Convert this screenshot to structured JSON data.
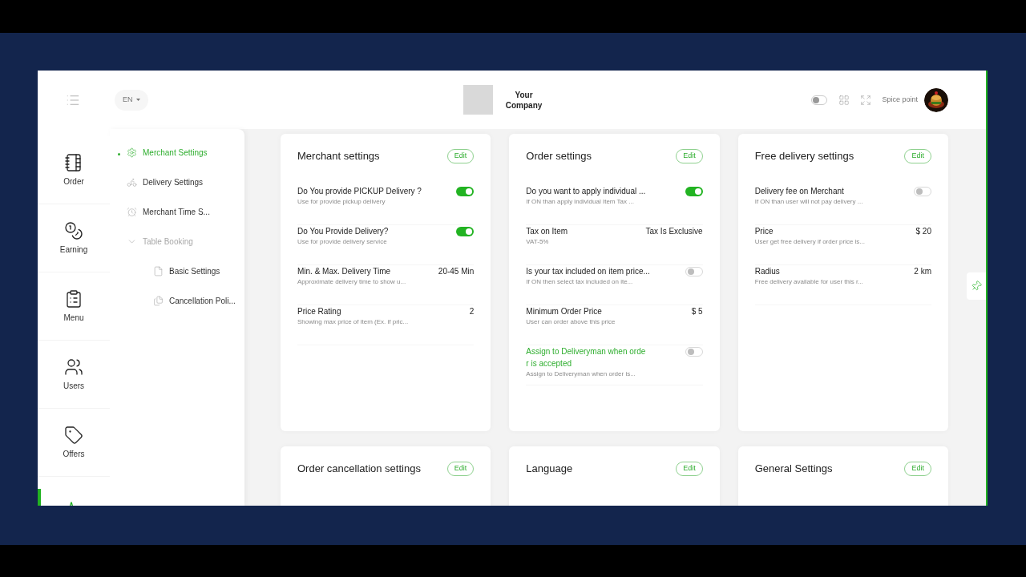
{
  "header": {
    "language": "EN",
    "company": "Your Company",
    "theme_toggle": {
      "on": false
    },
    "user_name": "Spice point"
  },
  "rail": [
    {
      "label": "Order",
      "selected": false
    },
    {
      "label": "Earning",
      "selected": false
    },
    {
      "label": "Menu",
      "selected": false
    },
    {
      "label": "Users",
      "selected": false
    },
    {
      "label": "Offers",
      "selected": false
    },
    {
      "selected": true
    }
  ],
  "submenu": [
    {
      "label": "Merchant Settings",
      "selected": true
    },
    {
      "label": "Delivery Settings",
      "selected": false
    },
    {
      "label": "Merchant Time S...",
      "selected": false
    },
    {
      "label": "Table Booking",
      "selected": false,
      "expanded": true,
      "children": [
        {
          "label": "Basic Settings",
          "selected": false
        },
        {
          "label": "Cancellation Poli...",
          "selected": false
        }
      ]
    }
  ],
  "cards": [
    {
      "title": "Merchant settings",
      "edit": "Edit",
      "rows": [
        {
          "kind": "toggle",
          "title": "Do You provide PICKUP Delivery ?",
          "subtitle": "Use for provide pickup delivery",
          "on": true
        },
        {
          "kind": "toggle",
          "title": "Do You Provide Delivery?",
          "subtitle": "Use for provide delivery service",
          "on": true
        },
        {
          "kind": "value",
          "title": "Min. & Max. Delivery Time",
          "subtitle": "Approximate delivery time to show u...",
          "value": "20-45 Min"
        },
        {
          "kind": "value",
          "title": "Price Rating",
          "subtitle": "Showing max price of item (Ex. if pric...",
          "value": "2"
        }
      ]
    },
    {
      "title": "Order settings",
      "edit": "Edit",
      "rows": [
        {
          "kind": "toggle",
          "title": "Do you want to apply individual ...",
          "subtitle": "If ON than apply individual Item Tax ...",
          "on": true
        },
        {
          "kind": "value",
          "title": "Tax on Item",
          "subtitle": "VAT-5%",
          "value": "Tax Is Exclusive"
        },
        {
          "kind": "toggle",
          "title": "Is your tax included on item price...",
          "subtitle": "If ON then select tax included on ite...",
          "on": false
        },
        {
          "kind": "value",
          "title": "Minimum Order Price",
          "subtitle": "User can order above this price",
          "value": "$ 5"
        },
        {
          "kind": "toggle",
          "title": "Assign to Deliveryman when orde r is accepted",
          "subtitle": "Assign to Deliveryman when order is...",
          "on": false,
          "highlighted": true
        }
      ]
    },
    {
      "title": "Free delivery settings",
      "edit": "Edit",
      "rows": [
        {
          "kind": "toggle",
          "title": "Delivery fee on Merchant",
          "subtitle": "If ON than user will not pay delivery ...",
          "on": false
        },
        {
          "kind": "value",
          "title": "Price",
          "subtitle": "User get free delivery if order price is...",
          "value": "$ 20"
        },
        {
          "kind": "value",
          "title": "Radius",
          "subtitle": "Free delivery available for user this r...",
          "value": "2 km"
        }
      ]
    },
    {
      "title": "Order cancellation settings",
      "edit": "Edit"
    },
    {
      "title": "Language",
      "edit": "Edit"
    },
    {
      "title": "General Settings",
      "edit": "Edit"
    }
  ]
}
